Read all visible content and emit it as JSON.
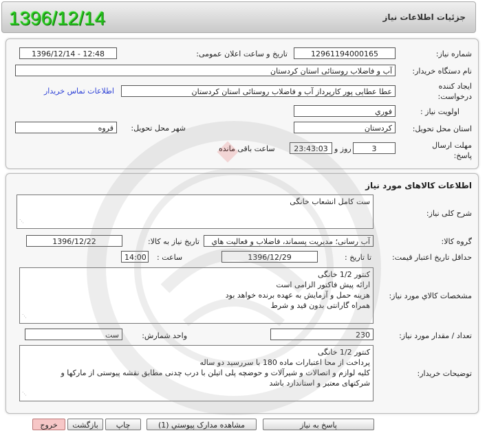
{
  "header": {
    "title": "جزئیات اطلاعات نیاز",
    "date_stamp": "1396/12/14"
  },
  "info": {
    "need_number_label": "شماره نیاز:",
    "need_number": "1296119400016‌5",
    "announce_label": "تاریخ و ساعت اعلان عمومی:",
    "announce_value": "1396/12/14 - 12:48",
    "buyer_org_label": "نام دستگاه خریدار:",
    "buyer_org": "آب و فاضلاب روستائی استان کردستان",
    "creator_label": "ایجاد کننده درخواست:",
    "creator": "عطا عطایی پور کارپرداز آب و فاضلاب روستائی استان کردستان",
    "contact_link": "اطلاعات تماس خریدار",
    "priority_label": "اولویت نیاز :",
    "priority": "فوري",
    "province_label": "استان محل تحویل:",
    "province": "کردستان",
    "city_label": "شهر محل تحویل:",
    "city": "قروه",
    "deadline_label": "مهلت ارسال پاسخ:",
    "days": "3",
    "days_label": "روز و",
    "time_left": "23:43:03",
    "time_left_label": "ساعت باقی مانده"
  },
  "goods": {
    "title": "اطلاعات کالاهای مورد نیاز",
    "summary_label": "شرح کلی نیاز:",
    "summary": "ست کامل انشعاب خانگی",
    "group_label": "گروه کالا:",
    "group": "آب رسانی؛ مدیریت پسماند، فاضلاب و فعالیت هاي",
    "need_date_label": "تاریخ نیاز به کالا:",
    "need_date": "1396/12/22",
    "validity_label": "حداقل تاریخ اعتبار قیمت:",
    "until_label": "تا تاریخ :",
    "validity_date": "1396/12/29",
    "hour_label": "ساعت :",
    "validity_time": "14:00",
    "specs_label": "مشخصات کالاي مورد نیاز:",
    "specs_lines": [
      "کنتور 1/2 خانگی",
      "ارائه پیش فاکتور الزامی است",
      "هزینه حمل و آزمایش به عهده برنده خواهد بود",
      "همراه گارانتی بدون قید و شرط"
    ],
    "qty_label": "تعداد / مقدار مورد نیاز:",
    "qty": "230",
    "unit_label": "واحد شمارش:",
    "unit": "ست",
    "buyer_notes_label": "توضیحات خریدار:",
    "buyer_notes_lines": [
      "کنتور 1/2 خانگی",
      "پرداخت از محا اعتبارات ماده   180 با سررسید دو ساله",
      "کلیه لوازم و اتصالات و شیرآلات و حوضچه پلی اتیلن با درب چدنی مطابق نقشه پیوستی از مارکها و",
      "شرکتهای معتبر و استاندارد باشد"
    ]
  },
  "buttons": {
    "reply": "پاسخ به نیاز",
    "attachments": "مشاهده مدارک پیوستي (1)",
    "print": "چاپ",
    "back": "بازگشت",
    "exit": "خروج"
  },
  "colors": {
    "date_stamp": "#24c31b",
    "link": "#2b3fd6",
    "exit_button": "#f7c7c7"
  }
}
